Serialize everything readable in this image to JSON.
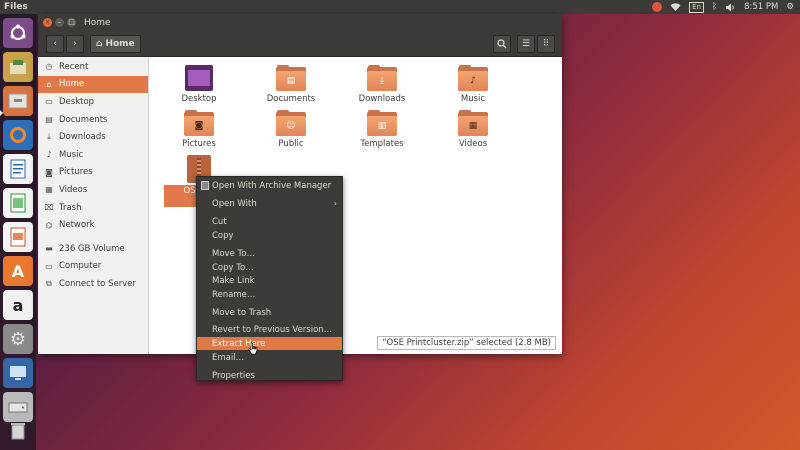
{
  "top_panel": {
    "app_title": "Files",
    "lang": "En",
    "time": "8:51 PM"
  },
  "window": {
    "title": "Home",
    "path_button": "Home"
  },
  "sidebar": {
    "items": [
      {
        "label": "Recent",
        "icon": "clock-icon"
      },
      {
        "label": "Home",
        "icon": "home-icon",
        "active": true
      },
      {
        "label": "Desktop",
        "icon": "desktop-icon"
      },
      {
        "label": "Documents",
        "icon": "document-icon"
      },
      {
        "label": "Downloads",
        "icon": "download-icon"
      },
      {
        "label": "Music",
        "icon": "music-icon"
      },
      {
        "label": "Pictures",
        "icon": "camera-icon"
      },
      {
        "label": "Videos",
        "icon": "film-icon"
      },
      {
        "label": "Trash",
        "icon": "trash-icon"
      },
      {
        "label": "Network",
        "icon": "network-icon"
      },
      {
        "label": "236 GB Volume",
        "icon": "drive-icon"
      },
      {
        "label": "Computer",
        "icon": "computer-icon"
      },
      {
        "label": "Connect to Server",
        "icon": "server-icon"
      }
    ]
  },
  "files": [
    {
      "label": "Desktop"
    },
    {
      "label": "Documents"
    },
    {
      "label": "Downloads"
    },
    {
      "label": "Music"
    },
    {
      "label": "Pictures"
    },
    {
      "label": "Public"
    },
    {
      "label": "Templates"
    },
    {
      "label": "Videos"
    },
    {
      "label": "OSE Printcluster.zip",
      "label_visible": "OSE Pri",
      "selected": true
    }
  ],
  "status": "“OSE Printcluster.zip” selected  (2.8 MB)",
  "context_menu": {
    "items": [
      {
        "label": "Open With Archive Manager"
      },
      {
        "label": "Open With",
        "submenu": true
      },
      {
        "label": "Cut"
      },
      {
        "label": "Copy"
      },
      {
        "label": "Move To…"
      },
      {
        "label": "Copy To…"
      },
      {
        "label": "Make Link"
      },
      {
        "label": "Rename…"
      },
      {
        "label": "Move to Trash"
      },
      {
        "label": "Revert to Previous Version…"
      },
      {
        "label": "Extract Here",
        "highlighted": true
      },
      {
        "label": "Email…"
      },
      {
        "label": "Properties"
      }
    ]
  },
  "colors": {
    "accent": "#e0784a",
    "panel": "#3c3b37"
  }
}
